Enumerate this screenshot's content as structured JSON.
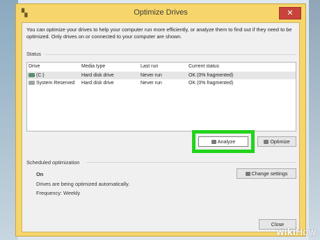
{
  "window": {
    "title": "Optimize Drives",
    "close_glyph": "✕"
  },
  "intro_text": "You can optimize your drives to help your computer run more efficiently, or analyze them to find out if they need to be optimized. Only drives on or connected to your computer are shown.",
  "status_label": "Status",
  "table": {
    "headers": [
      "Drive",
      "Media type",
      "Last run",
      "Current status"
    ],
    "rows": [
      {
        "drive": "(C:)",
        "media": "Hard disk drive",
        "last_run": "Never run",
        "status": "OK (0% fragmented)"
      },
      {
        "drive": "System Reserved",
        "media": "Hard disk drive",
        "last_run": "Never run",
        "status": "OK (0% fragmented)"
      }
    ]
  },
  "buttons": {
    "analyze": "Analyze",
    "optimize": "Optimize",
    "change_settings": "Change settings",
    "close": "Close"
  },
  "scheduled": {
    "label": "Scheduled optimization",
    "state": "On",
    "description": "Drives are being optimized automatically.",
    "frequency": "Frequency: Weekly"
  },
  "watermark": {
    "a": "wiki",
    "b": "How"
  },
  "colors": {
    "highlight": "#23d31c",
    "titlebar": "#f6d66b",
    "close": "#c7433b"
  }
}
